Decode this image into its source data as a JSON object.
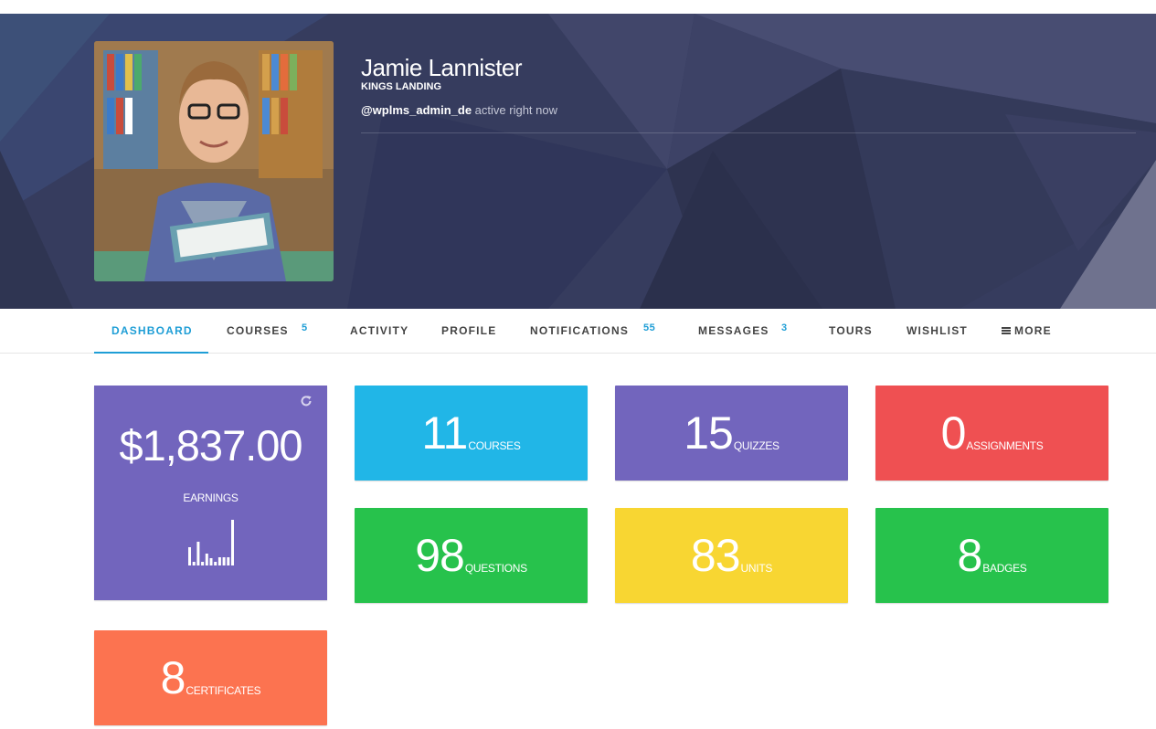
{
  "profile": {
    "name": "Jamie Lannister",
    "location": "KINGS LANDING",
    "handle": "@wplms_admin_de",
    "status": "active right now"
  },
  "tabs": [
    {
      "label": "DASHBOARD",
      "active": true
    },
    {
      "label": "COURSES",
      "count": "5"
    },
    {
      "label": "ACTIVITY"
    },
    {
      "label": "PROFILE"
    },
    {
      "label": "NOTIFICATIONS",
      "count": "55"
    },
    {
      "label": "MESSAGES",
      "count": "3"
    },
    {
      "label": "TOURS"
    },
    {
      "label": "WISHLIST"
    },
    {
      "label": "MORE",
      "icon": "menu-icon"
    }
  ],
  "earnings": {
    "amount": "$1,837.00",
    "label": "EARNINGS",
    "bars": [
      0.4,
      0.08,
      0.52,
      0.08,
      0.26,
      0.16,
      0.08,
      0.18,
      0.18,
      0.18,
      1.0
    ],
    "color": "#7265bd"
  },
  "stats": [
    {
      "value": "11",
      "label": "COURSES",
      "color": "#21b6e7"
    },
    {
      "value": "15",
      "label": "QUIZZES",
      "color": "#7265bd"
    },
    {
      "value": "0",
      "label": "ASSIGNMENTS",
      "color": "#ef5052"
    },
    {
      "value": "98",
      "label": "QUESTIONS",
      "color": "#27c24c"
    },
    {
      "value": "83",
      "label": "UNITS",
      "color": "#f8d632"
    },
    {
      "value": "8",
      "label": "BADGES",
      "color": "#27c24c"
    },
    {
      "value": "8",
      "label": "CERTIFICATES",
      "color": "#fc7350"
    }
  ],
  "accent": "#1f9ed6"
}
